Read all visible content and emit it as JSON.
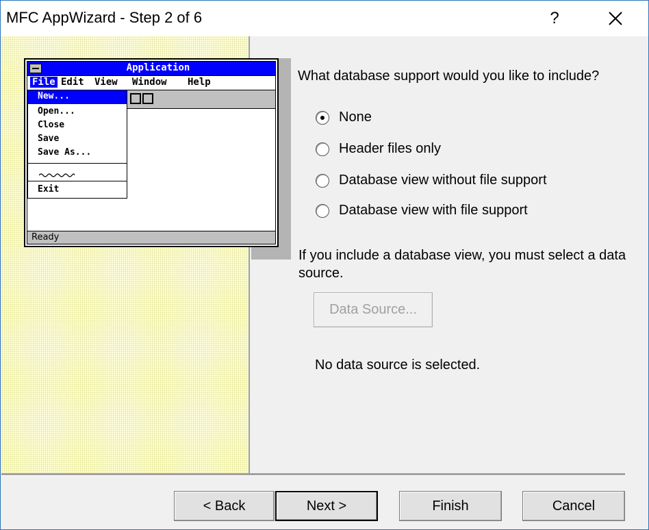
{
  "window": {
    "title": "MFC AppWizard - Step 2 of 6",
    "help_symbol": "?",
    "close_icon": "close-x-icon"
  },
  "illustration": {
    "title": "Application",
    "menubar": [
      "File",
      "Edit",
      "View",
      "Window",
      "Help"
    ],
    "file_menu": [
      "New...",
      "Open...",
      "Close",
      "Save",
      "Save As...",
      "Exit"
    ],
    "status": "Ready",
    "colors": {
      "titlebar": "#0000ff",
      "highlight": "#0000ff",
      "chrome": "#c0c0c0"
    }
  },
  "database": {
    "question": "What database support would you like to include?",
    "options": [
      {
        "label": "None",
        "selected": true
      },
      {
        "label": "Header files only",
        "selected": false
      },
      {
        "label": "Database view without file support",
        "selected": false
      },
      {
        "label": "Database view with file support",
        "selected": false
      }
    ],
    "info": "If you include a database view, you must select a data source.",
    "data_source_button": "Data Source...",
    "data_source_enabled": false,
    "status": "No data source is selected."
  },
  "footer": {
    "back": "< Back",
    "next": "Next >",
    "finish": "Finish",
    "cancel": "Cancel"
  }
}
